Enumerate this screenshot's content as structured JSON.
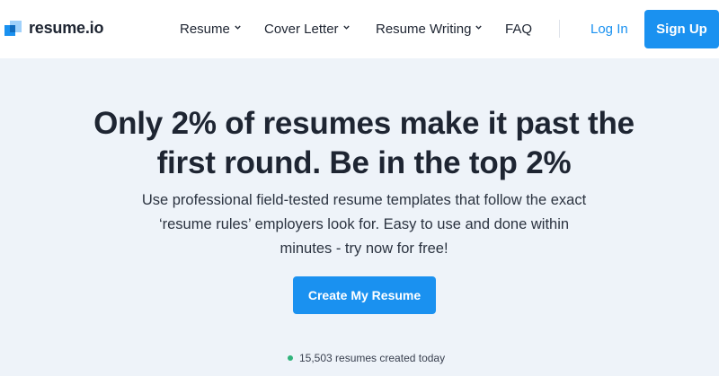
{
  "brand": {
    "name": "resume.io"
  },
  "nav": {
    "items": [
      {
        "label": "Resume",
        "has_dropdown": true
      },
      {
        "label": "Cover Letter",
        "has_dropdown": true
      },
      {
        "label": "Resume Writing",
        "has_dropdown": true
      },
      {
        "label": "FAQ",
        "has_dropdown": false
      }
    ],
    "login_label": "Log In",
    "signup_label": "Sign Up"
  },
  "hero": {
    "title_line1": "Only 2% of resumes make it past the",
    "title_line2": "first round. Be in the top 2%",
    "subtitle_line1": "Use professional field-tested resume templates that follow the exact",
    "subtitle_line2": "‘resume rules’ employers look for. Easy to use and done within",
    "subtitle_line3": "minutes - try now for free!",
    "cta_label": "Create My Resume",
    "counter_text": "15,503 resumes created today"
  },
  "colors": {
    "accent": "#1a91f0",
    "text": "#1e2532",
    "background": "#eef3f9",
    "status_dot": "#30b37b"
  }
}
